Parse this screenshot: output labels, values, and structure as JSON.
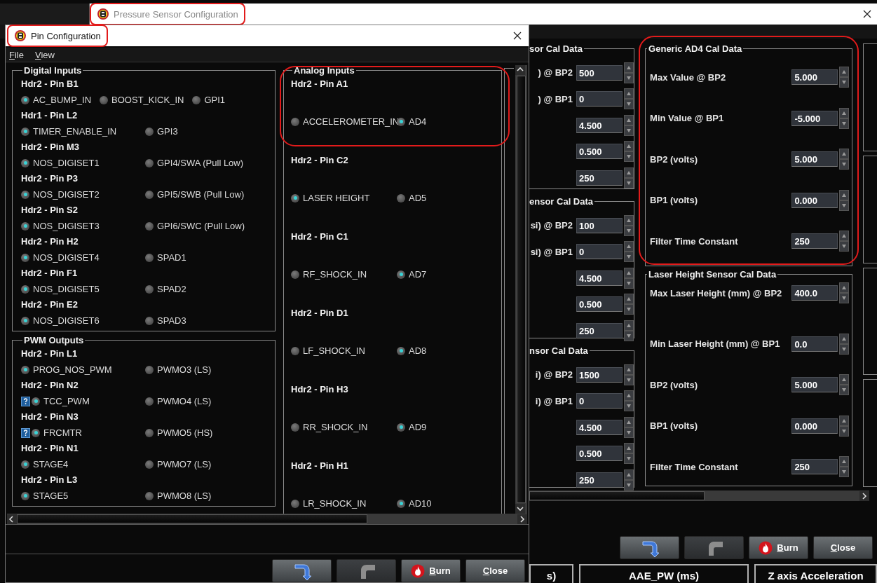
{
  "back_window": {
    "title": "Pressure Sensor Configuration",
    "highlighted": true,
    "partial_panels": [
      {
        "title": "sor Cal Data",
        "rows": [
          {
            "label": ") @ BP2",
            "value": "500"
          },
          {
            "label": ") @ BP1",
            "value": "0"
          },
          {
            "value": "4.500"
          },
          {
            "value": "0.500"
          },
          {
            "value": "250"
          }
        ]
      },
      {
        "title": "ensor Cal Data",
        "rows": [
          {
            "label": "si) @ BP2",
            "value": "100"
          },
          {
            "label": "si) @ BP1",
            "value": "0"
          },
          {
            "value": "4.500"
          },
          {
            "value": "0.500"
          },
          {
            "value": "250"
          }
        ]
      },
      {
        "title": "nsor Cal Data",
        "rows": [
          {
            "label": "i) @ BP2",
            "value": "1500"
          },
          {
            "label": "i) @ BP1",
            "value": "0"
          },
          {
            "value": "4.500"
          },
          {
            "value": "0.500"
          },
          {
            "value": "250"
          }
        ]
      }
    ],
    "panels": [
      {
        "title": "Generic AD4 Cal Data",
        "highlighted": true,
        "rows": [
          {
            "label": "Max Value @ BP2",
            "value": "5.000"
          },
          {
            "label": "Min Value @ BP1",
            "value": "-5.000"
          },
          {
            "label": "BP2 (volts)",
            "value": "5.000"
          },
          {
            "label": "BP1 (volts)",
            "value": "0.000"
          },
          {
            "label": "Filter Time Constant",
            "value": "250"
          }
        ]
      },
      {
        "title": "Laser Height Sensor Cal Data",
        "highlighted": false,
        "rows": [
          {
            "label": "Max Laser Height (mm) @ BP2",
            "value": "400.0"
          },
          {
            "label": "Min Laser Height (mm) @ BP1",
            "value": "0.0"
          },
          {
            "label": "BP2 (volts)",
            "value": "5.000"
          },
          {
            "label": "BP1 (volts)",
            "value": "0.000"
          },
          {
            "label": "Filter Time Constant",
            "value": "250"
          }
        ]
      }
    ],
    "buttons": [
      {
        "kind": "undo",
        "disabled": false
      },
      {
        "kind": "redo",
        "disabled": true
      },
      {
        "kind": "burn",
        "label": "Burn",
        "disabled": false
      },
      {
        "kind": "close",
        "label": "Close",
        "disabled": false
      }
    ],
    "gauges": [
      {
        "label": "s)"
      },
      {
        "label": "AAE_PW (ms)"
      },
      {
        "label": "Z axis Acceleration"
      }
    ]
  },
  "front_window": {
    "title": "Pin Configuration",
    "highlighted": true,
    "menu": [
      "File",
      "View"
    ],
    "sections": [
      {
        "title": "Digital Inputs",
        "groups": [
          {
            "header": "Hdr2 - Pin B1",
            "options": [
              {
                "label": "AC_BUMP_IN",
                "selected": true
              },
              {
                "label": "BOOST_KICK_IN",
                "selected": false
              },
              {
                "label": "GPI1",
                "selected": false
              }
            ]
          },
          {
            "header": "Hdr1 - Pin L2",
            "options": [
              {
                "label": "TIMER_ENABLE_IN",
                "selected": true
              },
              {
                "label": "GPI3",
                "selected": false
              }
            ]
          },
          {
            "header": "Hdr2 - Pin M3",
            "options": [
              {
                "label": "NOS_DIGISET1",
                "selected": true
              },
              {
                "label": "GPI4/SWA (Pull Low)",
                "selected": false
              }
            ]
          },
          {
            "header": "Hdr2 - Pin P3",
            "options": [
              {
                "label": "NOS_DIGISET2",
                "selected": true
              },
              {
                "label": "GPI5/SWB (Pull Low)",
                "selected": false
              }
            ]
          },
          {
            "header": "Hdr2 - Pin S2",
            "options": [
              {
                "label": "NOS_DIGISET3",
                "selected": true
              },
              {
                "label": "GPI6/SWC (Pull Low)",
                "selected": false
              }
            ]
          },
          {
            "header": "Hdr2 - Pin H2",
            "options": [
              {
                "label": "NOS_DIGISET4",
                "selected": true
              },
              {
                "label": "SPAD1",
                "selected": false
              }
            ]
          },
          {
            "header": "Hdr2 - Pin F1",
            "options": [
              {
                "label": "NOS_DIGISET5",
                "selected": true
              },
              {
                "label": "SPAD2",
                "selected": false
              }
            ]
          },
          {
            "header": "Hdr2 - Pin E2",
            "options": [
              {
                "label": "NOS_DIGISET6",
                "selected": true
              },
              {
                "label": "SPAD3",
                "selected": false
              }
            ]
          }
        ]
      },
      {
        "title": "PWM Outputs",
        "groups": [
          {
            "header": "Hdr2 - Pin L1",
            "options": [
              {
                "label": "PROG_NOS_PWM",
                "selected": true
              },
              {
                "label": "PWMO3 (LS)",
                "selected": false
              }
            ]
          },
          {
            "header": "Hdr2 - Pin N2",
            "options": [
              {
                "label": "TCC_PWM",
                "selected": true,
                "help": true
              },
              {
                "label": "PWMO4 (LS)",
                "selected": false
              }
            ]
          },
          {
            "header": "Hdr2 - Pin N3",
            "options": [
              {
                "label": "FRCMTR",
                "selected": true,
                "help": true
              },
              {
                "label": "PWMO5 (HS)",
                "selected": false
              }
            ]
          },
          {
            "header": "Hdr2 - Pin N1",
            "options": [
              {
                "label": "STAGE4",
                "selected": true
              },
              {
                "label": "PWMO7 (LS)",
                "selected": false
              }
            ]
          },
          {
            "header": "Hdr2 - Pin L3",
            "options": [
              {
                "label": "STAGE5",
                "selected": true
              },
              {
                "label": "PWMO8 (LS)",
                "selected": false
              }
            ]
          }
        ]
      }
    ],
    "analog": {
      "title": "Analog Inputs",
      "groups": [
        {
          "header": "Hdr2 - Pin A1",
          "highlighted": true,
          "options": [
            {
              "label": "ACCELEROMETER_IN",
              "selected": false
            },
            {
              "label": "AD4",
              "selected": true
            }
          ]
        },
        {
          "header": "Hdr2 - Pin C2",
          "highlighted": false,
          "options": [
            {
              "label": "LASER HEIGHT",
              "selected": true
            },
            {
              "label": "AD5",
              "selected": false
            }
          ]
        },
        {
          "header": "Hdr2 - Pin C1",
          "highlighted": false,
          "options": [
            {
              "label": "RF_SHOCK_IN",
              "selected": false
            },
            {
              "label": "AD7",
              "selected": true
            }
          ]
        },
        {
          "header": "Hdr2 - Pin D1",
          "highlighted": false,
          "options": [
            {
              "label": "LF_SHOCK_IN",
              "selected": false
            },
            {
              "label": "AD8",
              "selected": true
            }
          ]
        },
        {
          "header": "Hdr2 - Pin H3",
          "highlighted": false,
          "options": [
            {
              "label": "RR_SHOCK_IN",
              "selected": false
            },
            {
              "label": "AD9",
              "selected": true
            }
          ]
        },
        {
          "header": "Hdr2 - Pin H1",
          "highlighted": false,
          "options": [
            {
              "label": "LR_SHOCK_IN",
              "selected": false
            },
            {
              "label": "AD10",
              "selected": true
            }
          ]
        }
      ]
    },
    "buttons": [
      {
        "kind": "undo",
        "disabled": false
      },
      {
        "kind": "redo",
        "disabled": true
      },
      {
        "kind": "burn",
        "label": "Burn",
        "disabled": false
      },
      {
        "kind": "close",
        "label": "Close",
        "disabled": false
      }
    ]
  }
}
